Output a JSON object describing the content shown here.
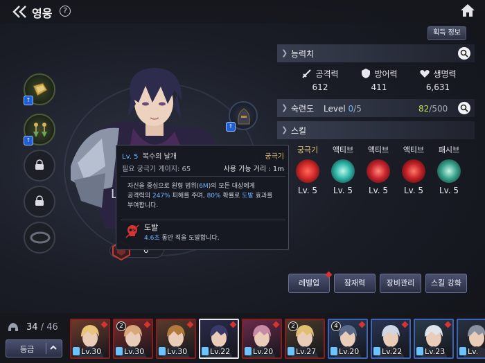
{
  "header": {
    "title": "영웅",
    "help": "?"
  },
  "source_button": "획득 정보",
  "abilities": {
    "title": "능력치",
    "stats": [
      {
        "name": "공격력",
        "value": "612",
        "icon": "sword-icon"
      },
      {
        "name": "방어력",
        "value": "411",
        "icon": "shield-icon"
      },
      {
        "name": "생명력",
        "value": "6,631",
        "icon": "heart-icon"
      }
    ]
  },
  "mastery": {
    "title": "숙련도",
    "level_label": "Level",
    "level": "0",
    "level_max": "/5",
    "exp": "82",
    "exp_max": "/500"
  },
  "skills": {
    "title": "스킬",
    "items": [
      {
        "type": "궁극기",
        "level": "Lv. 5",
        "color": "#d42a2a"
      },
      {
        "type": "액티브",
        "level": "Lv. 5",
        "color": "#2fb7a8"
      },
      {
        "type": "액티브",
        "level": "Lv. 5",
        "color": "#c9252e"
      },
      {
        "type": "액티브",
        "level": "Lv. 5",
        "color": "#c42227"
      },
      {
        "type": "패시브",
        "level": "Lv. 5",
        "color": "#3aa58e"
      }
    ]
  },
  "tooltip": {
    "level": "Lv. 5",
    "name": "복수의 날개",
    "type": "궁극기",
    "gauge": "필요 궁극기 게이지: 65",
    "range": "사용 가능 거리 : 1m",
    "desc_1a": "자신을 중심으로 원형 범위(",
    "desc_1b": "6M",
    "desc_1c": ")의 모든 대상에게",
    "desc_2a": "공격력의 ",
    "desc_2b": "247%",
    "desc_2c": " 피해를 주며, ",
    "desc_2d": "80%",
    "desc_2e": " 확률로 ",
    "desc_2f": "도발",
    "desc_2g": " 효과를",
    "desc_3": "부여합니다.",
    "taunt_title": "도발",
    "taunt_duration": "4.6초",
    "taunt_desc": " 동안 적을 도발합니다."
  },
  "hero_level_badge": "0",
  "hero_name_partial": "L",
  "actions": [
    {
      "label": "레벨업",
      "alert": true
    },
    {
      "label": "잠재력",
      "alert": false
    },
    {
      "label": "장비관리",
      "alert": false
    },
    {
      "label": "스킬 강화",
      "alert": false
    }
  ],
  "roster": {
    "count": "34",
    "total": "/ 46",
    "grade_label": "등급",
    "cards": [
      {
        "level": "Lv.30",
        "rank": "",
        "alert": true,
        "bg": "#6b3a2a",
        "hair": "#e8c47a"
      },
      {
        "level": "Lv.30",
        "rank": "2",
        "alert": true,
        "bg": "#7a2a2a",
        "hair": "#d9a87a"
      },
      {
        "level": "Lv.30",
        "rank": "",
        "alert": true,
        "bg": "#5a3a2a",
        "hair": "#b07a3a"
      },
      {
        "level": "Lv.22",
        "rank": "",
        "alert": true,
        "bg": "#2a2a4a",
        "hair": "#3a3a6a"
      },
      {
        "level": "Lv.20",
        "rank": "",
        "alert": true,
        "bg": "#6a2a4a",
        "hair": "#c88aa8"
      },
      {
        "level": "Lv.27",
        "rank": "2",
        "alert": false,
        "bg": "#4a3a2a",
        "hair": "#e0c070"
      },
      {
        "level": "Lv.20",
        "rank": "4",
        "alert": true,
        "bg": "#2a3a5a",
        "hair": "#5a6a8a"
      },
      {
        "level": "Lv.22",
        "rank": "",
        "alert": true,
        "bg": "#2a3350",
        "hair": "#cfd6e6"
      },
      {
        "level": "Lv.23",
        "rank": "",
        "alert": true,
        "bg": "#2a3a4a",
        "hair": "#e0e4ec"
      },
      {
        "level": "Lv.",
        "rank": "",
        "alert": false,
        "bg": "#2a3040",
        "hair": "#8a90a0"
      }
    ]
  },
  "colors": {
    "accent_blue": "#6fb5ff",
    "ultimate_gold": "#e4c56d",
    "exp_green": "#bfe05a",
    "alert_red": "#d63333"
  }
}
